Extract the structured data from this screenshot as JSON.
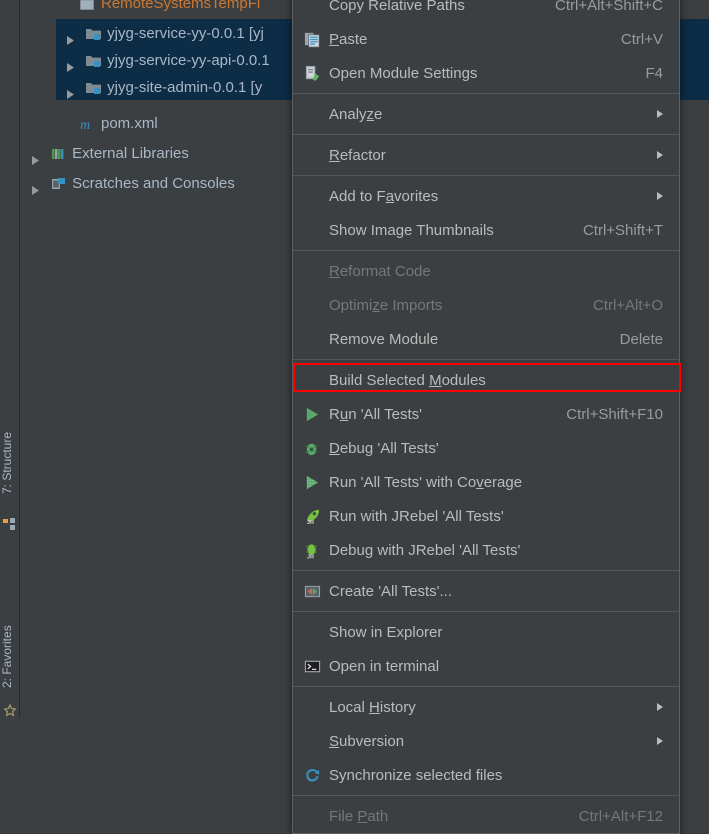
{
  "tool_stripe": {
    "structure_label": "7: Structure",
    "favorites_label": "2: Favorites"
  },
  "project_tree": {
    "items": [
      {
        "label": "RemoteSystemsTempFi",
        "icon": "folder-icon",
        "color": "#cc7832",
        "indent": 58,
        "arrow": false,
        "clipped": true
      },
      {
        "label": "yjyg-service-yy-0.0.1 [yj",
        "icon": "module-icon",
        "indent": 36,
        "arrow": true,
        "selected": true
      },
      {
        "label": "yjyg-service-yy-api-0.0.1",
        "icon": "module-icon",
        "indent": 36,
        "arrow": true,
        "selected": true
      },
      {
        "label": "yjyg-site-admin-0.0.1 [y",
        "icon": "module-icon",
        "indent": 36,
        "arrow": true,
        "selected": true
      },
      {
        "label": "pom.xml",
        "icon": "maven-m-icon",
        "indent": 58,
        "arrow": false
      },
      {
        "label": "External Libraries",
        "icon": "libraries-icon",
        "indent": 14,
        "arrow": true
      },
      {
        "label": "Scratches and Consoles",
        "icon": "scratches-icon",
        "indent": 14,
        "arrow": true
      }
    ]
  },
  "context_menu": {
    "items": [
      {
        "label": "Copy Relative Paths",
        "shortcut": "Ctrl+Alt+Shift+C",
        "icon": null,
        "accel": null,
        "disabled": false
      },
      {
        "label": "Paste",
        "shortcut": "Ctrl+V",
        "icon": "paste-icon",
        "accel": "P",
        "disabled": false
      },
      {
        "label": "Open Module Settings",
        "shortcut": "F4",
        "icon": "module-settings-icon",
        "accel": null,
        "disabled": false
      },
      {
        "separator": true
      },
      {
        "label": "Analyze",
        "shortcut": null,
        "icon": null,
        "accel": "z",
        "submenu": true,
        "disabled": false
      },
      {
        "separator": true
      },
      {
        "label": "Refactor",
        "shortcut": null,
        "icon": null,
        "accel": "R",
        "submenu": true,
        "disabled": false
      },
      {
        "separator": true
      },
      {
        "label": "Add to Favorites",
        "shortcut": null,
        "icon": null,
        "accel": "a",
        "submenu": true,
        "disabled": false
      },
      {
        "label": "Show Image Thumbnails",
        "shortcut": "Ctrl+Shift+T",
        "icon": null,
        "accel": null,
        "disabled": false
      },
      {
        "separator": true
      },
      {
        "label": "Reformat Code",
        "shortcut": null,
        "icon": null,
        "accel": "R",
        "disabled": true
      },
      {
        "label": "Optimize Imports",
        "shortcut": "Ctrl+Alt+O",
        "icon": null,
        "accel": "z",
        "disabled": true
      },
      {
        "label": "Remove Module",
        "shortcut": "Delete",
        "icon": null,
        "accel": null,
        "disabled": false
      },
      {
        "separator": true
      },
      {
        "label": "Build Selected Modules",
        "shortcut": null,
        "icon": null,
        "accel": "M",
        "disabled": false,
        "highlighted": true
      },
      {
        "label": "Run 'All Tests'",
        "shortcut": "Ctrl+Shift+F10",
        "icon": "run-icon",
        "accel": "u",
        "disabled": false
      },
      {
        "label": "Debug 'All Tests'",
        "shortcut": null,
        "icon": "debug-icon",
        "accel": "D",
        "disabled": false
      },
      {
        "label": "Run 'All Tests' with Coverage",
        "shortcut": null,
        "icon": "coverage-icon",
        "accel": "v",
        "disabled": false
      },
      {
        "label": "Run with JRebel 'All Tests'",
        "shortcut": null,
        "icon": "jrebel-run-icon",
        "accel": null,
        "disabled": false
      },
      {
        "label": "Debug with JRebel 'All Tests'",
        "shortcut": null,
        "icon": "jrebel-debug-icon",
        "accel": null,
        "disabled": false
      },
      {
        "separator": true
      },
      {
        "label": "Create 'All Tests'...",
        "shortcut": null,
        "icon": "create-config-icon",
        "accel": null,
        "disabled": false
      },
      {
        "separator": true
      },
      {
        "label": "Show in Explorer",
        "shortcut": null,
        "icon": null,
        "accel": null,
        "disabled": false
      },
      {
        "label": "Open in terminal",
        "shortcut": null,
        "icon": "terminal-icon",
        "accel": null,
        "disabled": false
      },
      {
        "separator": true
      },
      {
        "label": "Local History",
        "shortcut": null,
        "icon": null,
        "accel": "H",
        "submenu": true,
        "disabled": false
      },
      {
        "label": "Subversion",
        "shortcut": null,
        "icon": null,
        "accel": "S",
        "submenu": true,
        "disabled": false
      },
      {
        "label": "Synchronize selected files",
        "shortcut": null,
        "icon": "synchronize-icon",
        "accel": null,
        "disabled": false
      },
      {
        "separator": true
      },
      {
        "label": "File Path",
        "shortcut": "Ctrl+Alt+F12",
        "icon": null,
        "accel": "P",
        "disabled": true
      }
    ]
  },
  "colors": {
    "menu_background": "#3c3f41",
    "menu_text": "#bbbbbb",
    "disabled_text": "#777777",
    "tree_selection": "#0d2c46",
    "highlight_box": "#ff0000",
    "accent_blue": "#3592c4",
    "orange_text": "#cc7832"
  }
}
